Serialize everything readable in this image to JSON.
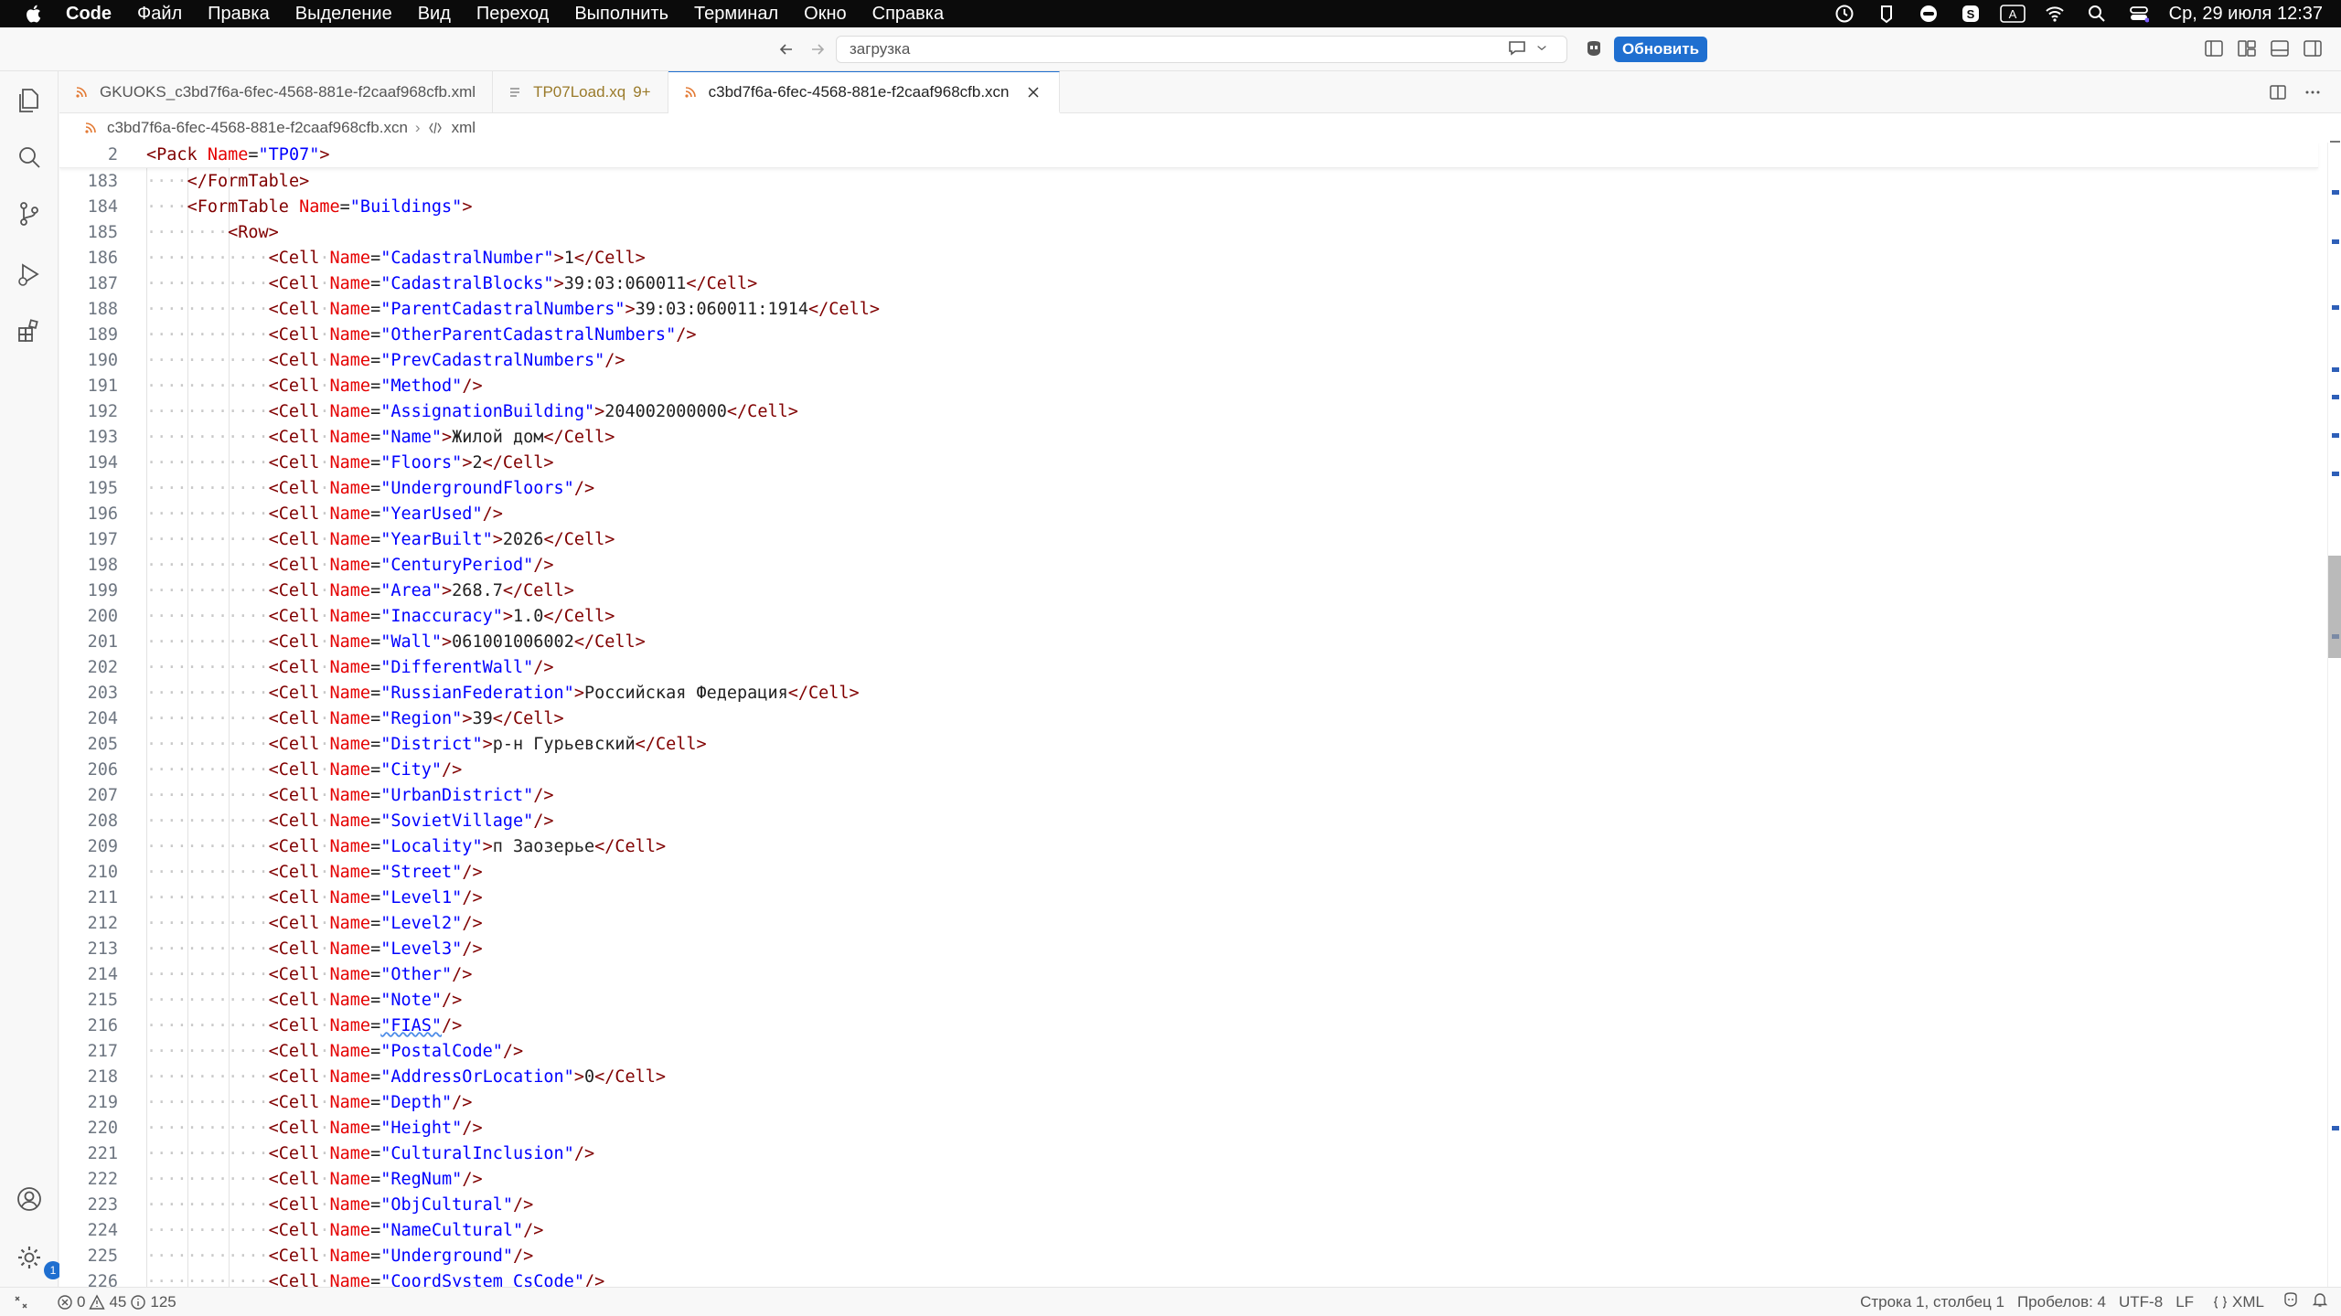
{
  "menubar": {
    "app_name": "Code",
    "items": [
      "Файл",
      "Правка",
      "Выделение",
      "Вид",
      "Переход",
      "Выполнить",
      "Терминал",
      "Окно",
      "Справка"
    ],
    "clock": "Ср, 29 июля  12:37",
    "tray_keyboard": "A"
  },
  "titlebar": {
    "search_text": "загрузка",
    "update_label": "Обновить"
  },
  "tabs": [
    {
      "label": "GKUOKS_c3bd7f6a-6fec-4568-881e-f2caaf968cfb.xml",
      "count": ""
    },
    {
      "label": "TP07Load.xq",
      "count": "9+"
    },
    {
      "label": "c3bd7f6a-6fec-4568-881e-f2caaf968cfb.xcn",
      "count": ""
    }
  ],
  "breadcrumb": {
    "file": "c3bd7f6a-6fec-4568-881e-f2caaf968cfb.xcn",
    "node": "xml"
  },
  "editor": {
    "sticky": {
      "num": "2",
      "tag_open": "<Pack ",
      "attr": "Name",
      "eq": "=",
      "val": "\"TP07\"",
      "tag_close": ">"
    },
    "line183": {
      "num": "183",
      "text": "</FormTable>"
    },
    "line184": {
      "num": "184",
      "tag_open": "<FormTable ",
      "attr": "Name",
      "eq": "=",
      "val": "\"Buildings\"",
      "tag_close": ">"
    },
    "line185": {
      "num": "185",
      "text": "<Row>"
    },
    "cells": [
      {
        "num": "186",
        "name": "\"CadastralNumber\"",
        "value": "1"
      },
      {
        "num": "187",
        "name": "\"CadastralBlocks\"",
        "value": "39:03:060011"
      },
      {
        "num": "188",
        "name": "\"ParentCadastralNumbers\"",
        "value": "39:03:060011:1914"
      },
      {
        "num": "189",
        "name": "\"OtherParentCadastralNumbers\"",
        "value": ""
      },
      {
        "num": "190",
        "name": "\"PrevCadastralNumbers\"",
        "value": ""
      },
      {
        "num": "191",
        "name": "\"Method\"",
        "value": ""
      },
      {
        "num": "192",
        "name": "\"AssignationBuilding\"",
        "value": "204002000000"
      },
      {
        "num": "193",
        "name": "\"Name\"",
        "value": "Жилой дом"
      },
      {
        "num": "194",
        "name": "\"Floors\"",
        "value": "2"
      },
      {
        "num": "195",
        "name": "\"UndergroundFloors\"",
        "value": ""
      },
      {
        "num": "196",
        "name": "\"YearUsed\"",
        "value": ""
      },
      {
        "num": "197",
        "name": "\"YearBuilt\"",
        "value": "2026"
      },
      {
        "num": "198",
        "name": "\"CenturyPeriod\"",
        "value": ""
      },
      {
        "num": "199",
        "name": "\"Area\"",
        "value": "268.7"
      },
      {
        "num": "200",
        "name": "\"Inaccuracy\"",
        "value": "1.0"
      },
      {
        "num": "201",
        "name": "\"Wall\"",
        "value": "061001006002"
      },
      {
        "num": "202",
        "name": "\"DifferentWall\"",
        "value": ""
      },
      {
        "num": "203",
        "name": "\"RussianFederation\"",
        "value": "Российская Федерация"
      },
      {
        "num": "204",
        "name": "\"Region\"",
        "value": "39"
      },
      {
        "num": "205",
        "name": "\"District\"",
        "value": "р-н Гурьевский"
      },
      {
        "num": "206",
        "name": "\"City\"",
        "value": ""
      },
      {
        "num": "207",
        "name": "\"UrbanDistrict\"",
        "value": ""
      },
      {
        "num": "208",
        "name": "\"SovietVillage\"",
        "value": ""
      },
      {
        "num": "209",
        "name": "\"Locality\"",
        "value": "п Заозерье"
      },
      {
        "num": "210",
        "name": "\"Street\"",
        "value": ""
      },
      {
        "num": "211",
        "name": "\"Level1\"",
        "value": ""
      },
      {
        "num": "212",
        "name": "\"Level2\"",
        "value": ""
      },
      {
        "num": "213",
        "name": "\"Level3\"",
        "value": ""
      },
      {
        "num": "214",
        "name": "\"Other\"",
        "value": ""
      },
      {
        "num": "215",
        "name": "\"Note\"",
        "value": ""
      },
      {
        "num": "216",
        "name": "\"FIAS\"",
        "value": ""
      },
      {
        "num": "217",
        "name": "\"PostalCode\"",
        "value": ""
      },
      {
        "num": "218",
        "name": "\"AddressOrLocation\"",
        "value": "0"
      },
      {
        "num": "219",
        "name": "\"Depth\"",
        "value": ""
      },
      {
        "num": "220",
        "name": "\"Height\"",
        "value": ""
      },
      {
        "num": "221",
        "name": "\"CulturalInclusion\"",
        "value": ""
      },
      {
        "num": "222",
        "name": "\"RegNum\"",
        "value": ""
      },
      {
        "num": "223",
        "name": "\"ObjCultural\"",
        "value": ""
      },
      {
        "num": "224",
        "name": "\"NameCultural\"",
        "value": ""
      },
      {
        "num": "225",
        "name": "\"Underground\"",
        "value": ""
      },
      {
        "num": "226",
        "name": "\"CoordSystem CsCode\"",
        "value": ""
      }
    ]
  },
  "statusbar": {
    "errors": "0",
    "warnings": "45",
    "info": "125",
    "position": "Строка 1, столбец 1",
    "spaces": "Пробелов: 4",
    "encoding": "UTF-8",
    "eol": "LF",
    "language": "XML"
  },
  "colors": {
    "accent": "#1f6fd0",
    "tag": "#800000",
    "attribute": "#e50000",
    "string": "#0000ff"
  }
}
